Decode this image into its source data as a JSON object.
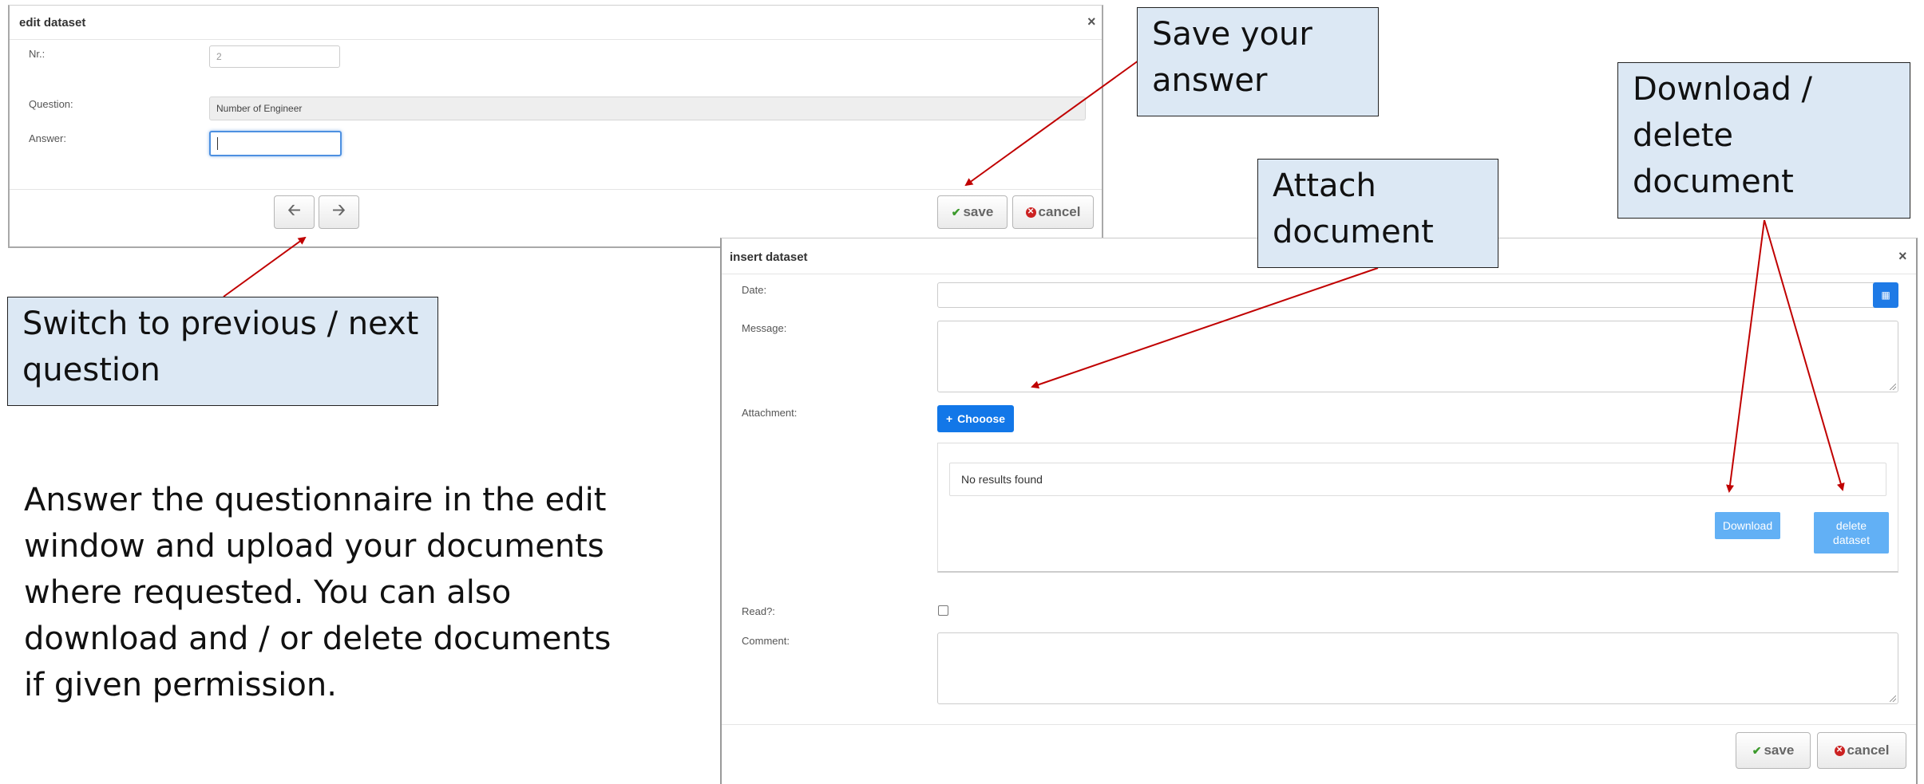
{
  "edit_dialog": {
    "title": "edit dataset",
    "close": "×",
    "nr_label": "Nr.:",
    "nr_value": "2",
    "question_label": "Question:",
    "question_value": "Number of Engineer",
    "answer_label": "Answer:",
    "answer_value": "",
    "prev_icon": "arrow-left-icon",
    "next_icon": "arrow-right-icon",
    "save_label": "save",
    "cancel_label": "cancel"
  },
  "insert_dialog": {
    "title": "insert dataset",
    "close": "×",
    "date_label": "Date:",
    "date_value": "",
    "message_label": "Message:",
    "attachment_label": "Attachment:",
    "choose_label": "Chooose",
    "no_results": "No results found",
    "download_label": "Download",
    "delete_label": "delete dataset",
    "read_label": "Read?:",
    "read_checked": false,
    "comment_label": "Comment:",
    "save_label": "save",
    "cancel_label": "cancel"
  },
  "callouts": {
    "save_answer": "Save your answer",
    "attach_document": "Attach document",
    "download_delete": "Download / delete document",
    "switch_question": "Switch to previous / next question"
  },
  "instructions": "Answer the questionnaire in the edit window and upload your documents where requested. You can also download and / or delete documents if given permission.",
  "colors": {
    "annotation_arrow": "#c00000",
    "callout_bg": "#dce8f4",
    "primary_button": "#1277e8",
    "light_button": "#62b0f5"
  }
}
